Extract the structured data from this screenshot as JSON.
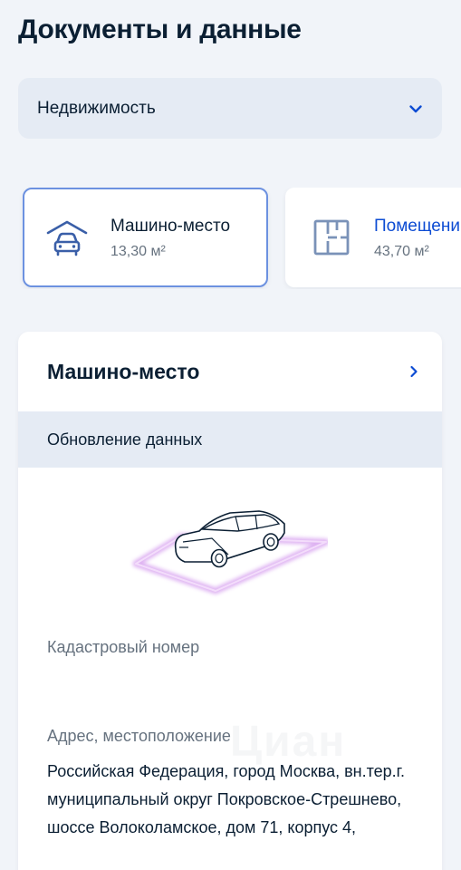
{
  "page": {
    "title": "Документы и данные"
  },
  "category_select": {
    "value": "Недвижимость",
    "icon": "chevron-down-icon"
  },
  "property_cards": [
    {
      "title": "Машино-место",
      "area": "13,30 м²",
      "icon": "garage-car-icon",
      "selected": true
    },
    {
      "title": "Помещени",
      "area": "43,70 м²",
      "icon": "floor-plan-icon",
      "selected": false
    }
  ],
  "detail": {
    "title": "Машино-место",
    "banner": "Обновление данных",
    "cadastral_label": "Кадастровый номер",
    "address_label": "Адрес, местоположение",
    "address_value": "Российская Федерация, город Москва, вн.тер.г. муниципальный округ Покровское-Стрешнево, шоссе Волоколамское, дом 71, корпус 4,"
  },
  "watermark": "Циан",
  "colors": {
    "background": "#f1f4f9",
    "select_bg": "#e5ebf4",
    "accent": "#0d4cd3",
    "selected_border": "#6c91e0",
    "muted_text": "#66727f",
    "icon_blue": "#3a5fa8",
    "parking_glow": "#d9a6f0"
  }
}
